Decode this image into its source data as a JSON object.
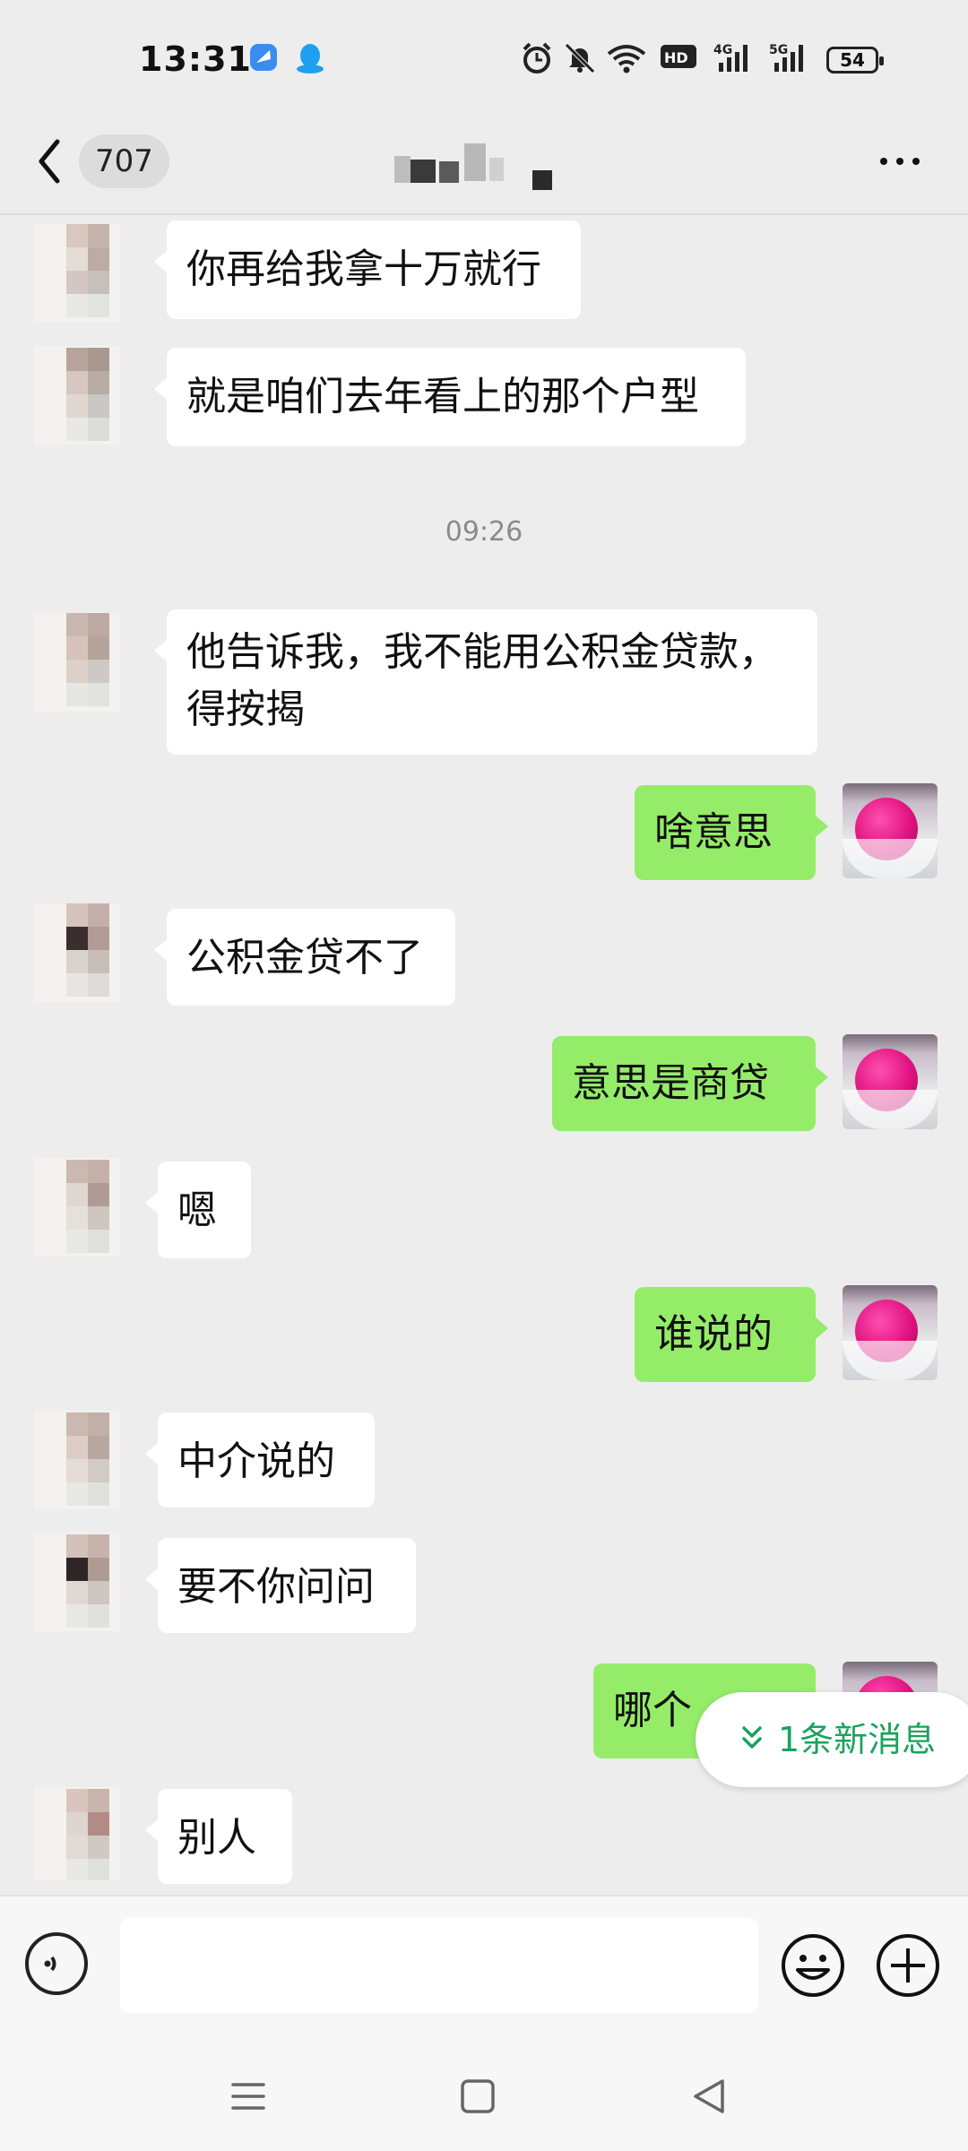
{
  "status_bar": {
    "time": "13:31",
    "battery": "54",
    "icons": [
      "blue-app-icon",
      "qq-penguin-icon",
      "alarm-icon",
      "mute-icon",
      "wifi-icon",
      "hd-icon",
      "signal-4g-icon",
      "signal-5g-icon",
      "battery-icon"
    ]
  },
  "header": {
    "unread_count": "707",
    "back_icon": "chevron-left-icon",
    "more_icon": "more-dots-icon"
  },
  "chat": {
    "timestamp": "09:26",
    "messages": [
      {
        "side": "in",
        "text": "你再给我拿十万就行"
      },
      {
        "side": "in",
        "text": "就是咱们去年看上的那个户型"
      },
      {
        "side": "in",
        "text": "他告诉我，我不能用公积金贷款，得按揭"
      },
      {
        "side": "out",
        "text": "啥意思"
      },
      {
        "side": "in",
        "text": "公积金贷不了"
      },
      {
        "side": "out",
        "text": "意思是商贷"
      },
      {
        "side": "in",
        "text": "嗯"
      },
      {
        "side": "out",
        "text": "谁说的"
      },
      {
        "side": "in",
        "text": "中介说的"
      },
      {
        "side": "in",
        "text": "要不你问问"
      },
      {
        "side": "out",
        "text": "哪个"
      },
      {
        "side": "in",
        "text": "别人"
      }
    ],
    "new_message_pill": "1条新消息"
  },
  "input_bar": {
    "message_value": "",
    "voice_icon": "voice-icon",
    "emoji_icon": "emoji-icon",
    "plus_icon": "plus-icon"
  },
  "nav_bar": {
    "icons": [
      "menu-icon",
      "home-square-icon",
      "back-triangle-icon"
    ]
  },
  "colors": {
    "background": "#ededed",
    "outgoing_bubble": "#95ec69",
    "incoming_bubble": "#ffffff",
    "accent_green": "#1aa35c"
  }
}
